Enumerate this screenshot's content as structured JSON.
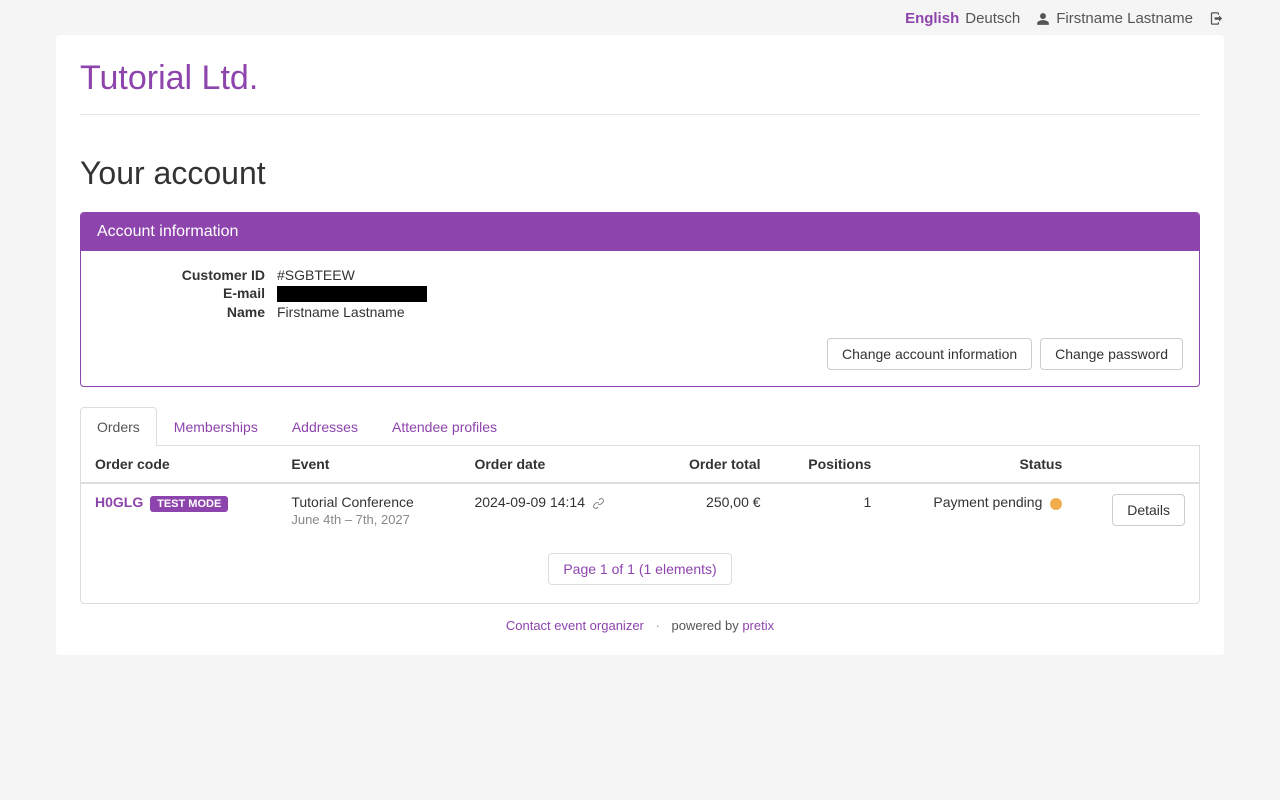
{
  "topbar": {
    "lang_active": "English",
    "lang_inactive": "Deutsch",
    "username": "Firstname Lastname"
  },
  "brand": "Tutorial Ltd.",
  "page_title": "Your account",
  "account_panel": {
    "header": "Account information",
    "customer_id_label": "Customer ID",
    "customer_id_value": "#SGBTEEW",
    "email_label": "E-mail",
    "name_label": "Name",
    "name_value": "Firstname Lastname",
    "btn_change_info": "Change account information",
    "btn_change_password": "Change password"
  },
  "tabs": {
    "orders": "Orders",
    "memberships": "Memberships",
    "addresses": "Addresses",
    "attendee_profiles": "Attendee profiles"
  },
  "orders_table": {
    "headers": {
      "code": "Order code",
      "event": "Event",
      "date": "Order date",
      "total": "Order total",
      "positions": "Positions",
      "status": "Status"
    },
    "rows": [
      {
        "code": "H0GLG",
        "badge": "TEST MODE",
        "event_name": "Tutorial Conference",
        "event_sub": "June 4th – 7th, 2027",
        "date": "2024-09-09 14:14",
        "total": "250,00 €",
        "positions": "1",
        "status": "Payment pending",
        "details_label": "Details"
      }
    ],
    "pager": "Page 1 of 1 (1 elements)"
  },
  "footer": {
    "contact": "Contact event organizer",
    "powered_by": "powered by",
    "pretix": "pretix"
  }
}
